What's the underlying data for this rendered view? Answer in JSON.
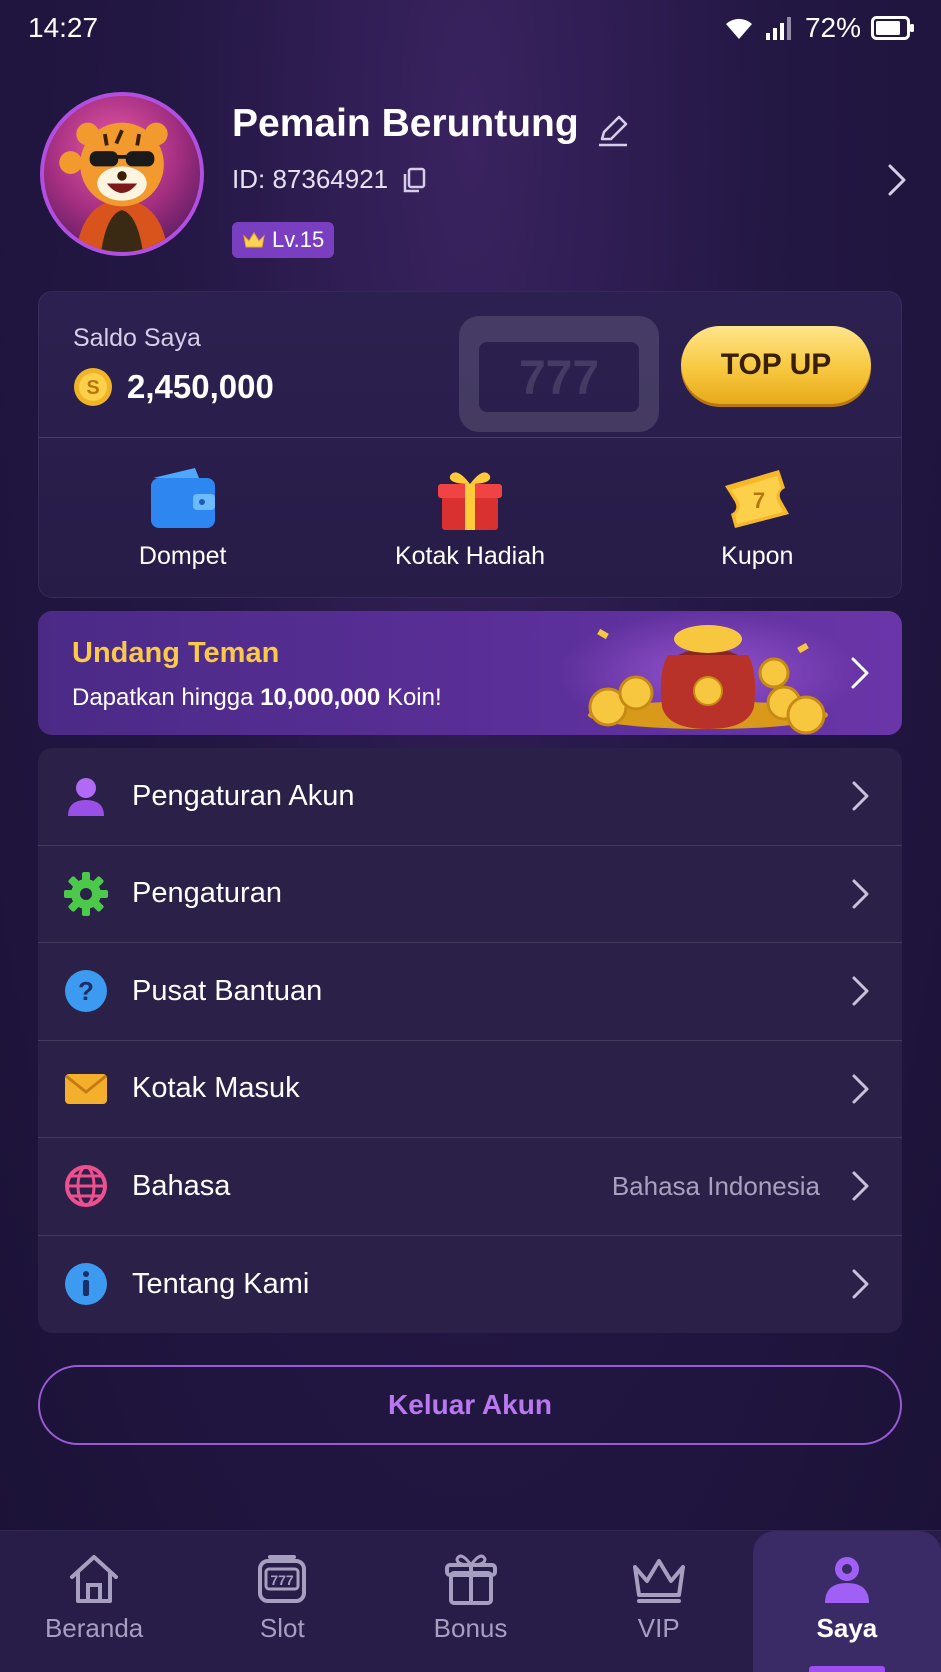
{
  "status_bar": {
    "time": "14:27",
    "battery": "72%"
  },
  "profile": {
    "name": "Pemain Beruntung",
    "id_text": "ID: 87364921",
    "level": "Lv.15"
  },
  "wallet": {
    "label": "Saldo Saya",
    "balance": "2,450,000",
    "topup_label": "TOP UP",
    "actions": [
      {
        "label": "Dompet",
        "icon": "wallet-icon"
      },
      {
        "label": "Kotak Hadiah",
        "icon": "gift-box-icon"
      },
      {
        "label": "Kupon",
        "icon": "coupon-icon"
      }
    ]
  },
  "invite": {
    "title": "Undang Teman",
    "subtitle_prefix": "Dapatkan hingga ",
    "subtitle_amount": "10,000,000",
    "subtitle_suffix": " Koin!"
  },
  "menu": [
    {
      "label": "Pengaturan Akun",
      "icon": "user-icon",
      "value": ""
    },
    {
      "label": "Pengaturan",
      "icon": "gear-icon",
      "value": ""
    },
    {
      "label": "Pusat Bantuan",
      "icon": "help-icon",
      "value": ""
    },
    {
      "label": "Kotak Masuk",
      "icon": "mail-icon",
      "value": ""
    },
    {
      "label": "Bahasa",
      "icon": "globe-icon",
      "value": "Bahasa Indonesia"
    },
    {
      "label": "Tentang Kami",
      "icon": "info-icon",
      "value": ""
    }
  ],
  "logout_label": "Keluar Akun",
  "nav": [
    {
      "label": "Beranda",
      "icon": "home-icon",
      "active": false
    },
    {
      "label": "Slot",
      "icon": "slot-machine-icon",
      "active": false
    },
    {
      "label": "Bonus",
      "icon": "gift-icon",
      "active": false
    },
    {
      "label": "VIP",
      "icon": "crown-icon",
      "active": false
    },
    {
      "label": "Saya",
      "icon": "user-icon",
      "active": true
    }
  ],
  "colors": {
    "accent": "#9d4df0",
    "gold": "#f7c83f",
    "background": "#231744"
  }
}
